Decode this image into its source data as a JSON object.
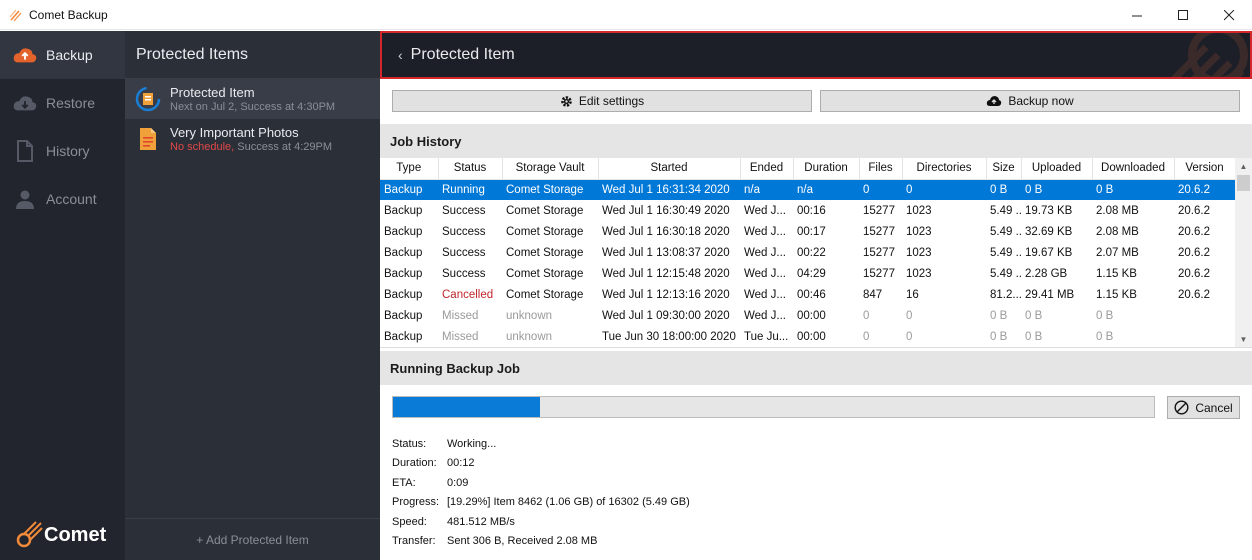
{
  "window": {
    "title": "Comet Backup",
    "minimize": "—",
    "maximize": "☐",
    "close": "✕"
  },
  "nav": {
    "items": [
      {
        "label": "Backup",
        "icon": "cloud-upload-icon",
        "active": true
      },
      {
        "label": "Restore",
        "icon": "cloud-download-icon",
        "active": false
      },
      {
        "label": "History",
        "icon": "document-icon",
        "active": false
      },
      {
        "label": "Account",
        "icon": "user-icon",
        "active": false
      }
    ],
    "logo": "Comet"
  },
  "items_panel": {
    "title": "Protected Items",
    "items": [
      {
        "label": "Protected Item",
        "sub": "Next on Jul 2, Success at 4:30PM",
        "sub_alert": ""
      },
      {
        "label": "Very Important Photos",
        "sub_alert": "No schedule,",
        "sub": " Success at 4:29PM"
      }
    ],
    "add_label": "+ Add Protected Item"
  },
  "main": {
    "header_title": "Protected Item",
    "back_icon": "‹",
    "buttons": {
      "edit": "Edit settings",
      "backup": "Backup now"
    },
    "job_history_title": "Job History",
    "columns": [
      "Type",
      "Status",
      "Storage Vault",
      "Started",
      "Ended",
      "Duration",
      "Files",
      "Directories",
      "Size",
      "Uploaded",
      "Downloaded",
      "Version"
    ],
    "rows": [
      {
        "cells": [
          "Backup",
          "Running",
          "Comet Storage",
          "Wed Jul 1 16:31:34 2020",
          "n/a",
          "n/a",
          "0",
          "0",
          "0 B",
          "0 B",
          "0 B",
          "20.6.2"
        ],
        "state": "selected"
      },
      {
        "cells": [
          "Backup",
          "Success",
          "Comet Storage",
          "Wed Jul 1 16:30:49 2020",
          "Wed J...",
          "00:16",
          "15277",
          "1023",
          "5.49 ...",
          "19.73 KB",
          "2.08 MB",
          "20.6.2"
        ],
        "state": "normal"
      },
      {
        "cells": [
          "Backup",
          "Success",
          "Comet Storage",
          "Wed Jul 1 16:30:18 2020",
          "Wed J...",
          "00:17",
          "15277",
          "1023",
          "5.49 ...",
          "32.69 KB",
          "2.08 MB",
          "20.6.2"
        ],
        "state": "normal"
      },
      {
        "cells": [
          "Backup",
          "Success",
          "Comet Storage",
          "Wed Jul 1 13:08:37 2020",
          "Wed J...",
          "00:22",
          "15277",
          "1023",
          "5.49 ...",
          "19.67 KB",
          "2.07 MB",
          "20.6.2"
        ],
        "state": "normal"
      },
      {
        "cells": [
          "Backup",
          "Success",
          "Comet Storage",
          "Wed Jul 1 12:15:48 2020",
          "Wed J...",
          "04:29",
          "15277",
          "1023",
          "5.49 ...",
          "2.28 GB",
          "1.15 KB",
          "20.6.2"
        ],
        "state": "normal"
      },
      {
        "cells": [
          "Backup",
          "Cancelled",
          "Comet Storage",
          "Wed Jul 1 12:13:16 2020",
          "Wed J...",
          "00:46",
          "847",
          "16",
          "81.2...",
          "29.41 MB",
          "1.15 KB",
          "20.6.2"
        ],
        "state": "cancelled"
      },
      {
        "cells": [
          "Backup",
          "Missed",
          "unknown",
          "Wed Jul 1 09:30:00 2020",
          "Wed J...",
          "00:00",
          "0",
          "0",
          "0 B",
          "0 B",
          "0 B",
          ""
        ],
        "state": "missed"
      },
      {
        "cells": [
          "Backup",
          "Missed",
          "unknown",
          "Tue Jun 30 18:00:00 2020",
          "Tue Ju...",
          "00:00",
          "0",
          "0",
          "0 B",
          "0 B",
          "0 B",
          ""
        ],
        "state": "missed"
      }
    ],
    "running_title": "Running Backup Job",
    "progress_fraction": 0.1929,
    "cancel_label": "Cancel",
    "info": [
      {
        "k": "Status:",
        "v": "Working..."
      },
      {
        "k": "Duration:",
        "v": "00:12"
      },
      {
        "k": "ETA:",
        "v": "0:09"
      },
      {
        "k": "Progress:",
        "v": "[19.29%] Item 8462 (1.06 GB) of 16302 (5.49 GB)"
      },
      {
        "k": "Speed:",
        "v": "481.512 MB/s"
      },
      {
        "k": "Transfer:",
        "v": "Sent 306 B, Received 2.08 MB"
      }
    ]
  },
  "colors": {
    "accent": "#d3262d",
    "selection": "#0078d7",
    "progress": "#0a7bd6",
    "nav_bg": "#22252d"
  }
}
